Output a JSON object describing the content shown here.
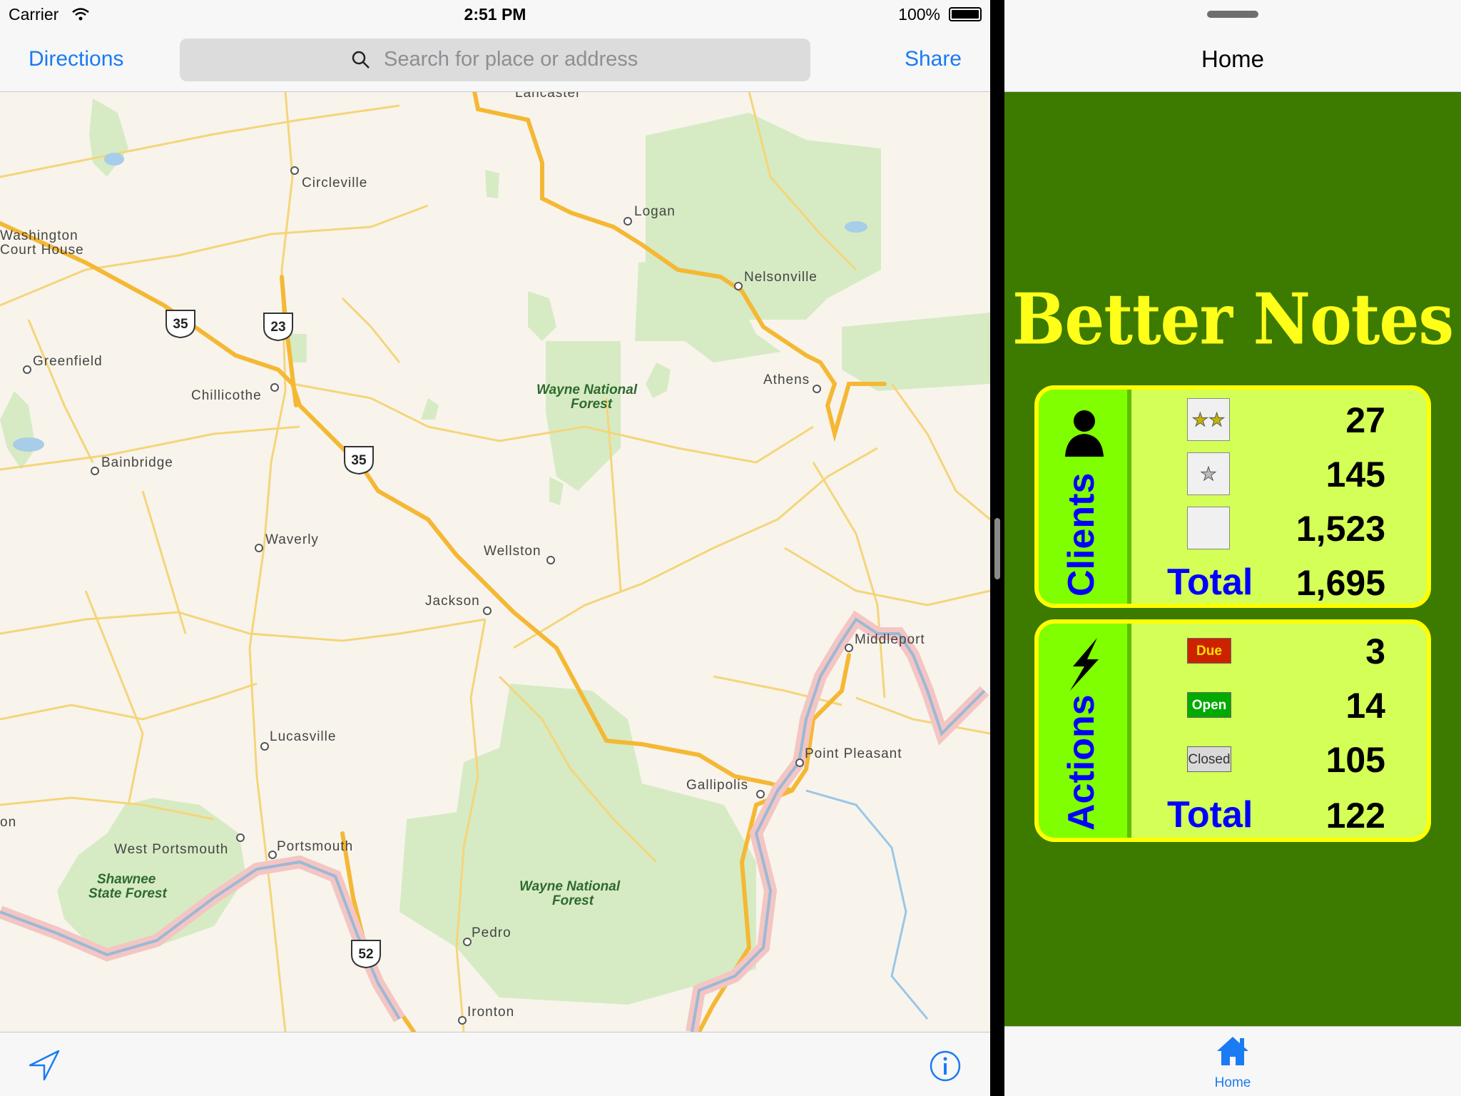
{
  "status_bar": {
    "carrier": "Carrier",
    "time": "2:51 PM",
    "battery": "100%"
  },
  "maps": {
    "directions_label": "Directions",
    "share_label": "Share",
    "search_placeholder": "Search for place or address",
    "cities": [
      "Lancaster",
      "Circleville",
      "Washington Court House",
      "Logan",
      "Nelsonville",
      "Greenfield",
      "Chillicothe",
      "Athens",
      "Bainbridge",
      "Waverly",
      "Wellston",
      "Jackson",
      "Middleport",
      "Lucasville",
      "Point Pleasant",
      "Gallipolis",
      "West Portsmouth",
      "Portsmouth",
      "Pedro",
      "Ironton"
    ],
    "forests": [
      "Wayne National Forest",
      "Shawnee State Forest"
    ],
    "route_shields": [
      "35",
      "23",
      "35",
      "52"
    ],
    "icons": [
      "location-arrow-icon",
      "info-icon",
      "search-icon",
      "wifi-icon",
      "battery-icon"
    ]
  },
  "notes_app": {
    "nav_title": "Home",
    "app_name": "Better Notes",
    "clients": {
      "label": "Clients",
      "rows": [
        {
          "tag": "two-stars",
          "value": "27"
        },
        {
          "tag": "one-star",
          "value": "145"
        },
        {
          "tag": "blank",
          "value": "1,523"
        }
      ],
      "total_label": "Total",
      "total_value": "1,695"
    },
    "actions": {
      "label": "Actions",
      "rows": [
        {
          "tag": "Due",
          "value": "3"
        },
        {
          "tag": "Open",
          "value": "14"
        },
        {
          "tag": "Closed",
          "value": "105"
        }
      ],
      "total_label": "Total",
      "total_value": "122"
    },
    "tab_home": "Home",
    "colors": {
      "background": "#3c7a00",
      "panel": "#d4ff57",
      "border": "#ffff00",
      "accent": "#0000ff",
      "due": "#cc2200",
      "open": "#00aa00"
    }
  }
}
